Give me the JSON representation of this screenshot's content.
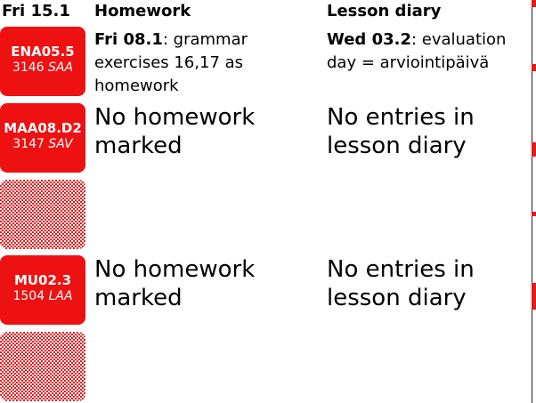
{
  "header": {
    "date": "Fri 15.1",
    "homework": "Homework",
    "lesson_diary": "Lesson diary"
  },
  "lessons": [
    {
      "code": "ENA05.5",
      "room": "3146",
      "teacher": "SAA",
      "homework": {
        "date": "Fri 08.1",
        "text": ": grammar exercises 16,17 as homework"
      },
      "diary": {
        "date": "Wed 03.2",
        "text": ": evaluation day = arviointipäivä"
      }
    },
    {
      "code": "MAA08.D2",
      "room": "3147",
      "teacher": "SAV",
      "homework_text": "No homework marked",
      "diary_text": "No entries in lesson diary"
    },
    {
      "code": "MU02.3",
      "room": "1504",
      "teacher": "LAA",
      "homework_text": "No homework marked",
      "diary_text": "No entries in lesson diary"
    }
  ],
  "colors": {
    "accent": "#ee1111",
    "text": "#000000",
    "background": "#ffffff"
  }
}
